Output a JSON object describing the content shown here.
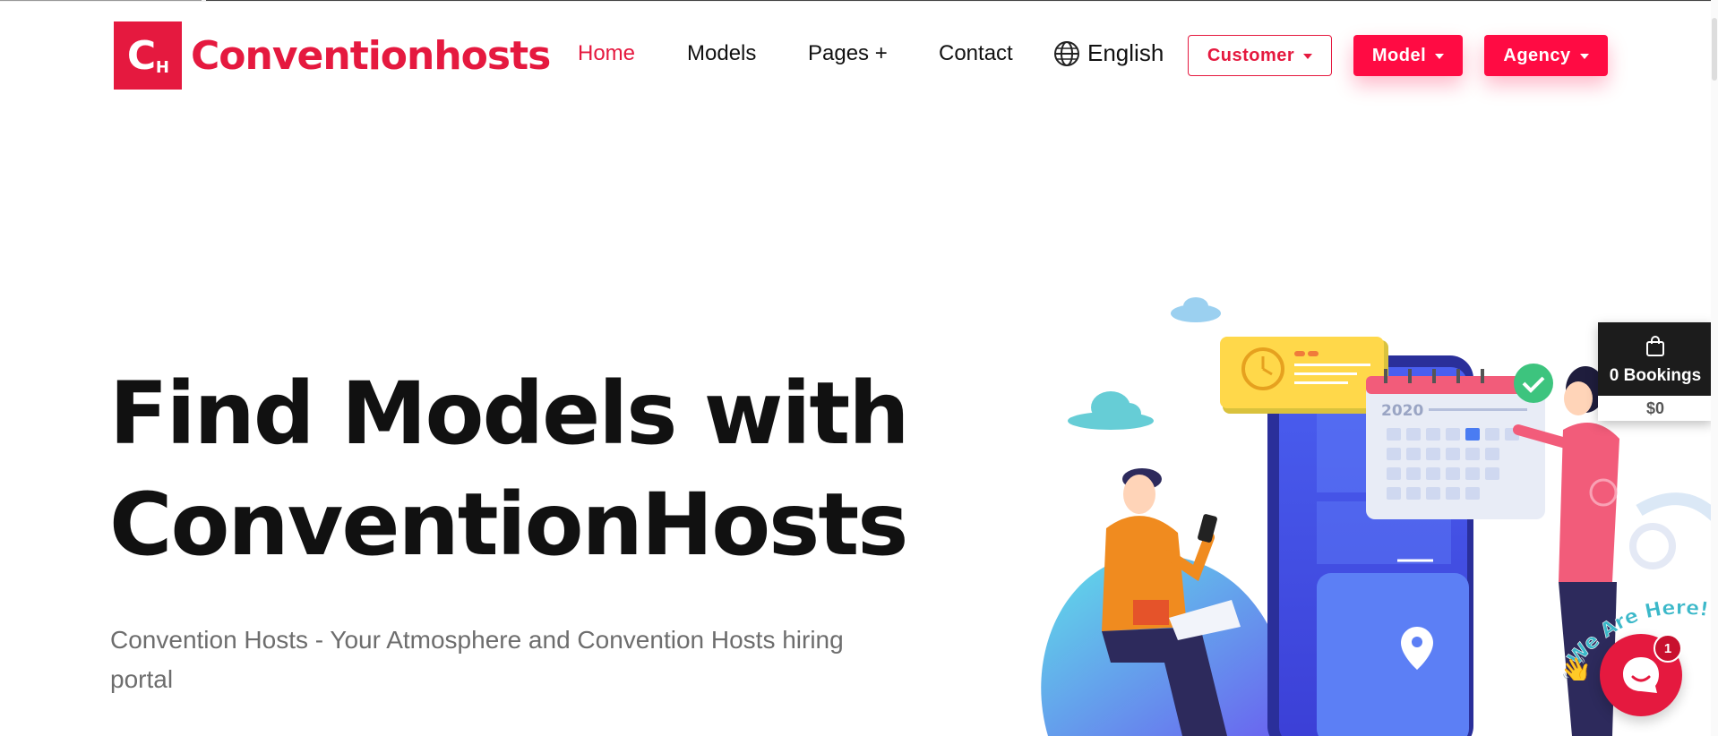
{
  "brand": {
    "logo_letters": "C",
    "logo_sub": "H",
    "name": "Conventionhosts",
    "color": "#e5193f"
  },
  "nav": {
    "items": [
      {
        "label": "Home",
        "active": true
      },
      {
        "label": "Models"
      },
      {
        "label": "Pages +"
      },
      {
        "label": "Contact"
      }
    ],
    "language": "English"
  },
  "buttons": {
    "customer": "Customer",
    "model": "Model",
    "agency": "Agency"
  },
  "hero": {
    "line1": "Find Models with",
    "line2": "ConventionHosts",
    "subtitle": "Convention Hosts - Your Atmosphere and Convention Hosts hiring portal"
  },
  "illustration": {
    "calendar_year": "2020"
  },
  "bookings_widget": {
    "count_label": "0 Bookings",
    "total": "$0"
  },
  "chat": {
    "banner": "We Are Here!",
    "badge_count": "1"
  },
  "colors": {
    "accent": "#ff0b43",
    "text": "#111111",
    "muted": "#6d6d6d"
  }
}
